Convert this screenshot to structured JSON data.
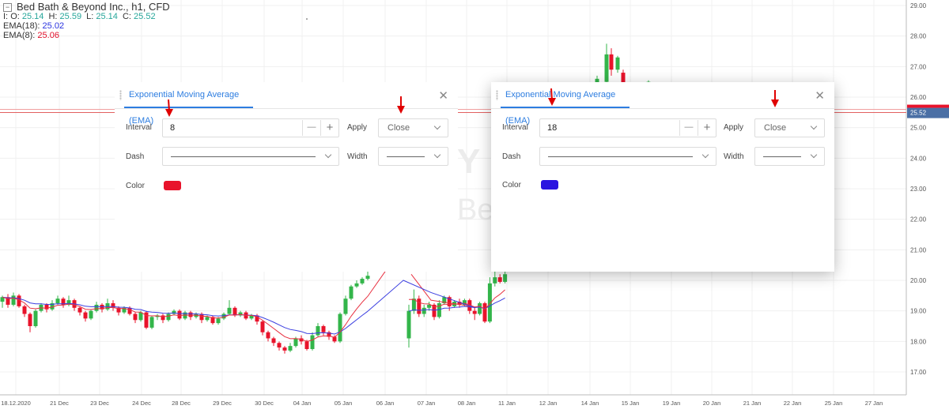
{
  "legend": {
    "title": "Bed Bath & Beyond Inc.,  h1,  CFD",
    "collapse_symbol": "−",
    "ohlc": [
      {
        "label": "O:",
        "value": "25.14"
      },
      {
        "label": "H:",
        "value": "25.59"
      },
      {
        "label": "L:",
        "value": "25.14"
      },
      {
        "label": "C:",
        "value": "25.52"
      }
    ],
    "ohlc_prefix": "I:",
    "ema18_label": "EMA(18):",
    "ema18_value": "25.02",
    "ema8_label": "EMA(8):",
    "ema8_value": "25.06"
  },
  "watermark": {
    "line1": "Y",
    "line2": "Be"
  },
  "price_axis": {
    "ticks": [
      "29.00",
      "28.00",
      "27.00",
      "26.00",
      "25.00",
      "24.00",
      "23.00",
      "22.00",
      "21.00",
      "20.00",
      "19.00",
      "18.00",
      "17.00"
    ],
    "current_price": "25.52"
  },
  "time_axis": {
    "ticks": [
      "18.12.2020",
      "21 Dec",
      "23 Dec",
      "24 Dec",
      "28 Dec",
      "29 Dec",
      "30 Dec",
      "04 Jan",
      "05 Jan",
      "06 Jan",
      "07 Jan",
      "08 Jan",
      "11 Jan",
      "12 Jan",
      "14 Jan",
      "15 Jan",
      "19 Jan",
      "20 Jan",
      "21 Jan",
      "22 Jan",
      "25 Jan",
      "27 Jan"
    ]
  },
  "colors": {
    "up": "#33b54a",
    "down": "#e8132b",
    "ema8": "#e83040",
    "ema18": "#3b3fe0",
    "accent": "#2d7de0",
    "arrow": "#e00000"
  },
  "chart_data": {
    "type": "candlestick",
    "title": "Bed Bath & Beyond Inc.,  h1,  CFD",
    "ylim": [
      16.6,
      29.1
    ],
    "candles": [
      [
        19.3,
        19.45,
        19.5,
        19.1
      ],
      [
        19.45,
        19.2,
        19.55,
        19.1
      ],
      [
        19.2,
        19.5,
        19.6,
        19.15
      ],
      [
        19.5,
        19.15,
        19.55,
        19.1
      ],
      [
        19.15,
        18.9,
        19.2,
        18.8
      ],
      [
        18.9,
        18.5,
        18.95,
        18.3
      ],
      [
        18.5,
        19.0,
        19.05,
        18.45
      ],
      [
        19.0,
        19.2,
        19.25,
        18.95
      ],
      [
        19.2,
        19.05,
        19.25,
        18.95
      ],
      [
        19.05,
        19.25,
        19.35,
        19.0
      ],
      [
        19.25,
        19.4,
        19.5,
        19.2
      ],
      [
        19.4,
        19.2,
        19.45,
        19.1
      ],
      [
        19.2,
        19.35,
        19.5,
        19.15
      ],
      [
        19.35,
        19.1,
        19.4,
        19.0
      ],
      [
        19.1,
        18.95,
        19.15,
        18.85
      ],
      [
        18.95,
        18.75,
        19.0,
        18.65
      ],
      [
        18.75,
        19.0,
        19.05,
        18.7
      ],
      [
        19.0,
        19.2,
        19.3,
        18.95
      ],
      [
        19.2,
        19.05,
        19.25,
        18.95
      ],
      [
        19.05,
        19.25,
        19.4,
        19.0
      ],
      [
        19.25,
        19.1,
        19.35,
        19.0
      ],
      [
        19.1,
        18.95,
        19.15,
        18.85
      ],
      [
        18.95,
        19.1,
        19.15,
        18.9
      ],
      [
        19.1,
        18.9,
        19.15,
        18.85
      ],
      [
        18.9,
        18.7,
        18.95,
        18.6
      ],
      [
        18.7,
        18.95,
        19.0,
        18.65
      ],
      [
        18.95,
        18.45,
        19.0,
        18.4
      ],
      [
        18.45,
        18.8,
        18.85,
        18.4
      ],
      [
        18.8,
        18.85,
        18.9,
        18.7
      ],
      [
        18.85,
        18.7,
        18.9,
        18.6
      ],
      [
        18.7,
        18.9,
        18.95,
        18.65
      ],
      [
        18.9,
        19.0,
        19.05,
        18.85
      ],
      [
        19.0,
        18.75,
        19.05,
        18.7
      ],
      [
        18.75,
        18.95,
        19.0,
        18.7
      ],
      [
        18.95,
        18.8,
        19.0,
        18.7
      ],
      [
        18.8,
        18.9,
        18.95,
        18.75
      ],
      [
        18.9,
        18.7,
        18.95,
        18.6
      ],
      [
        18.7,
        18.8,
        18.85,
        18.65
      ],
      [
        18.8,
        18.6,
        18.85,
        18.55
      ],
      [
        18.6,
        18.75,
        18.8,
        18.55
      ],
      [
        18.75,
        18.9,
        18.95,
        18.7
      ],
      [
        18.9,
        19.1,
        19.35,
        18.85
      ],
      [
        19.1,
        18.85,
        19.15,
        18.8
      ],
      [
        18.85,
        18.95,
        19.0,
        18.8
      ],
      [
        18.95,
        18.75,
        19.0,
        18.7
      ],
      [
        18.75,
        18.85,
        18.9,
        18.7
      ],
      [
        18.85,
        18.65,
        18.9,
        18.55
      ],
      [
        18.65,
        18.3,
        18.7,
        18.2
      ],
      [
        18.3,
        18.1,
        18.35,
        18.0
      ],
      [
        18.1,
        17.95,
        18.15,
        17.85
      ],
      [
        17.95,
        17.8,
        18.0,
        17.7
      ],
      [
        17.8,
        17.7,
        17.85,
        17.6
      ],
      [
        17.7,
        17.85,
        17.95,
        17.65
      ],
      [
        17.85,
        18.1,
        18.15,
        17.8
      ],
      [
        18.1,
        18.0,
        18.2,
        17.9
      ],
      [
        18.0,
        17.75,
        18.05,
        17.7
      ],
      [
        17.75,
        18.2,
        18.3,
        17.7
      ],
      [
        18.2,
        18.5,
        18.6,
        18.15
      ],
      [
        18.5,
        18.3,
        18.55,
        18.2
      ],
      [
        18.3,
        18.15,
        18.35,
        18.05
      ],
      [
        18.15,
        18.0,
        18.2,
        17.95
      ],
      [
        18.0,
        18.9,
        18.95,
        17.95
      ],
      [
        18.9,
        19.4,
        19.5,
        18.85
      ],
      [
        19.4,
        19.8,
        19.85,
        19.35
      ],
      [
        19.8,
        19.9,
        20.0,
        19.75
      ],
      [
        19.9,
        20.05,
        20.1,
        19.85
      ],
      [
        20.05,
        20.15,
        20.3,
        20.0
      ],
      [
        18.1,
        19.0,
        19.2,
        17.8
      ],
      [
        19.0,
        19.4,
        19.7,
        18.9
      ],
      [
        19.4,
        18.9,
        19.5,
        18.8
      ],
      [
        18.9,
        19.1,
        19.2,
        18.8
      ],
      [
        19.1,
        19.2,
        19.3,
        19.0
      ],
      [
        19.2,
        18.8,
        19.25,
        18.7
      ],
      [
        18.8,
        19.25,
        19.35,
        18.75
      ],
      [
        19.25,
        19.45,
        19.5,
        19.2
      ],
      [
        19.45,
        19.15,
        19.5,
        19.0
      ],
      [
        19.15,
        19.3,
        19.35,
        19.1
      ],
      [
        19.3,
        19.2,
        19.4,
        19.1
      ],
      [
        19.2,
        19.35,
        19.4,
        19.15
      ],
      [
        19.35,
        19.0,
        19.4,
        18.9
      ],
      [
        19.0,
        18.9,
        19.1,
        18.7
      ],
      [
        18.9,
        19.25,
        19.3,
        18.85
      ],
      [
        19.25,
        18.65,
        19.3,
        18.6
      ],
      [
        18.65,
        19.9,
        20.1,
        18.6
      ],
      [
        19.9,
        20.1,
        20.7,
        19.8
      ],
      [
        20.1,
        19.95,
        20.2,
        19.9
      ],
      [
        19.95,
        20.2,
        20.4,
        19.9
      ]
    ]
  },
  "dialog_left": {
    "tab": "Exponential Moving Average (EMA)",
    "interval_label": "Interval",
    "interval_value": "8",
    "minus": "—",
    "plus": "+",
    "apply_label": "Apply",
    "apply_value": "Close",
    "dash_label": "Dash",
    "width_label": "Width",
    "color_label": "Color",
    "color": "#e8132b",
    "close_symbol": "✕"
  },
  "dialog_right": {
    "tab": "Exponential Moving Average (EMA)",
    "interval_label": "Interval",
    "interval_value": "18",
    "minus": "—",
    "plus": "+",
    "apply_label": "Apply",
    "apply_value": "Close",
    "dash_label": "Dash",
    "width_label": "Width",
    "color_label": "Color",
    "color": "#2a14e0",
    "close_symbol": "✕"
  }
}
